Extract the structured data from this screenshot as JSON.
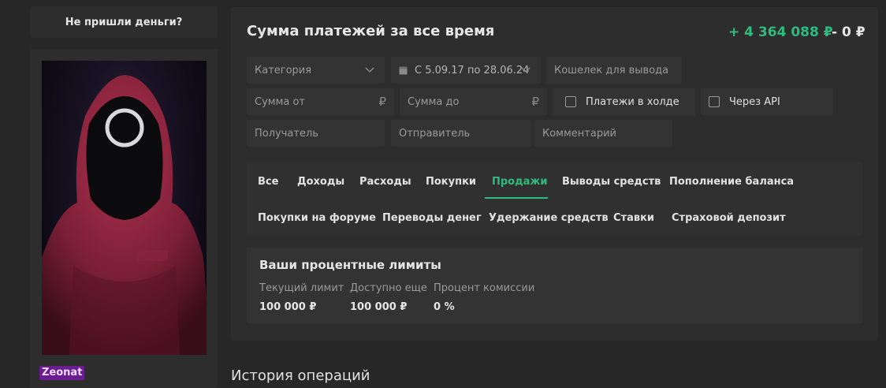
{
  "sidebar": {
    "help_button": "Не пришли деньги?",
    "username": "Zeonat"
  },
  "summary": {
    "title": "Сумма платежей за все время",
    "income": "+ 4 364 088 ₽",
    "outcome": "- 0 ₽"
  },
  "filters": {
    "category_placeholder": "Категория",
    "date_range": "С 5.09.17 по 28.06.24",
    "wallet_placeholder": "Кошелек для вывода",
    "amount_from_placeholder": "Сумма от",
    "amount_to_placeholder": "Сумма до",
    "currency_symbol": "₽",
    "hold_label": "Платежи в холде",
    "api_label": "Через API",
    "recipient_placeholder": "Получатель",
    "sender_placeholder": "Отправитель",
    "comment_placeholder": "Комментарий"
  },
  "tabs": [
    {
      "label": "Все"
    },
    {
      "label": "Доходы"
    },
    {
      "label": "Расходы"
    },
    {
      "label": "Покупки"
    },
    {
      "label": "Продажи",
      "active": true
    },
    {
      "label": "Выводы средств"
    },
    {
      "label": "Пополнение баланса"
    },
    {
      "label": "Покупки на форуме"
    },
    {
      "label": "Переводы денег"
    },
    {
      "label": "Удержание средств"
    },
    {
      "label": "Ставки"
    },
    {
      "label": "Страховой депозит"
    }
  ],
  "limits": {
    "title": "Ваши процентные лимиты",
    "items": [
      {
        "label": "Текущий лимит",
        "value": "100 000 ₽"
      },
      {
        "label": "Доступно еще",
        "value": "100 000 ₽"
      },
      {
        "label": "Процент комиссии",
        "value": "0 %"
      }
    ]
  },
  "history_title": "История операций",
  "colors": {
    "accent": "#2fbb7e",
    "background": "#272727",
    "panel": "#2d2d2d",
    "field": "#333333",
    "username_badge": "#6a1d8f"
  },
  "icons": {
    "dropdown": "chevron-down-icon",
    "calendar": "calendar-icon",
    "checkbox": "checkbox-icon",
    "avatar": "hooded-figure-image"
  }
}
